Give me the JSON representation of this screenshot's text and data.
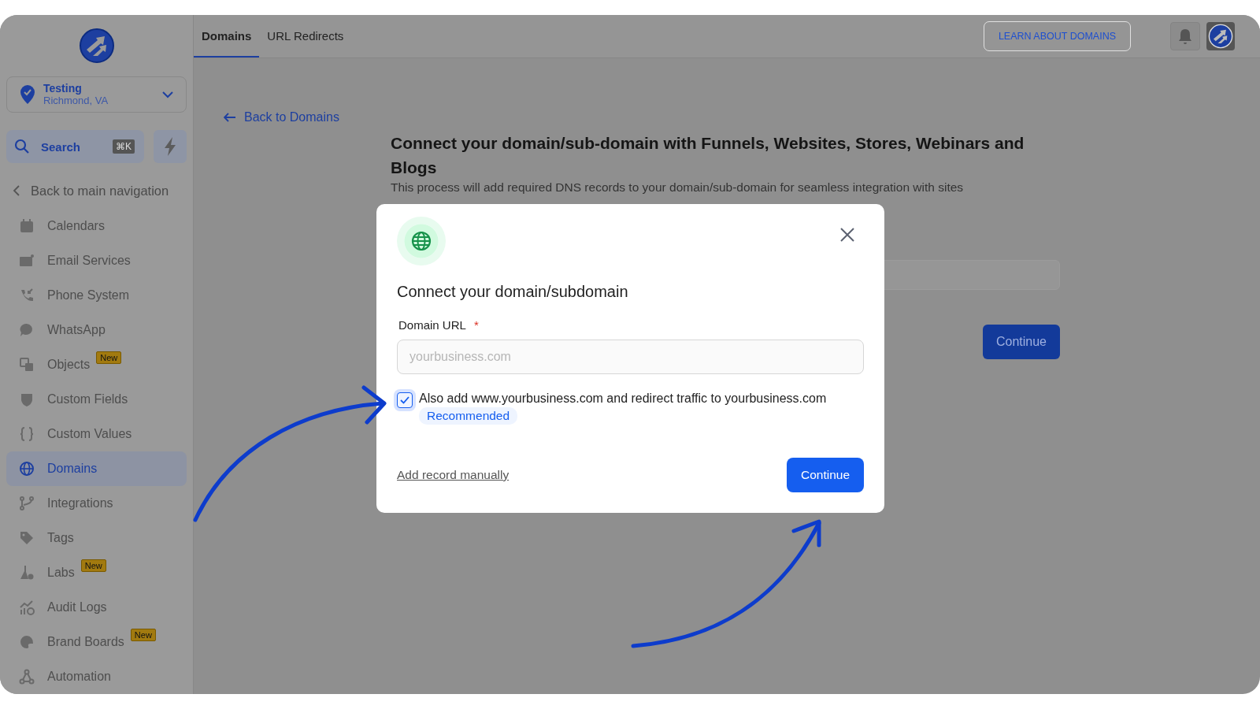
{
  "sidebar": {
    "location": {
      "name": "Testing",
      "city": "Richmond, VA"
    },
    "search": {
      "label": "Search",
      "shortcut": "⌘K"
    },
    "back_link": "Back to main navigation",
    "items": [
      {
        "label": "Calendars",
        "selected": false
      },
      {
        "label": "Email Services",
        "selected": false
      },
      {
        "label": "Phone System",
        "selected": false
      },
      {
        "label": "WhatsApp",
        "selected": false
      },
      {
        "label": "Objects",
        "selected": false,
        "badge": "New"
      },
      {
        "label": "Custom Fields",
        "selected": false
      },
      {
        "label": "Custom Values",
        "selected": false
      },
      {
        "label": "Domains",
        "selected": true
      },
      {
        "label": "Integrations",
        "selected": false
      },
      {
        "label": "Tags",
        "selected": false
      },
      {
        "label": "Labs",
        "selected": false,
        "badge": "New"
      },
      {
        "label": "Audit Logs",
        "selected": false
      },
      {
        "label": "Brand Boards",
        "selected": false,
        "badge": "New"
      },
      {
        "label": "Automation",
        "selected": false
      }
    ]
  },
  "tabs": [
    {
      "label": "Domains",
      "selected": true
    },
    {
      "label": "URL Redirects",
      "selected": false
    }
  ],
  "header_button": "LEARN ABOUT DOMAINS",
  "page": {
    "back_link": "Back to Domains",
    "heading": "Connect your domain/sub-domain with Funnels, Websites, Stores, Webinars and Blogs",
    "description": "This process will add required DNS records to your domain/sub-domain for seamless integration with sites",
    "button": "Continue"
  },
  "modal": {
    "title": "Connect your domain/subdomain",
    "field_label": "Domain URL",
    "required_mark": "*",
    "placeholder": "yourbusiness.com",
    "checkbox": {
      "label": "Also add www.yourbusiness.com and redirect traffic to yourbusiness.com",
      "checked": true,
      "tag": "Recommended"
    },
    "link": "Add record manually",
    "button": "Continue"
  }
}
